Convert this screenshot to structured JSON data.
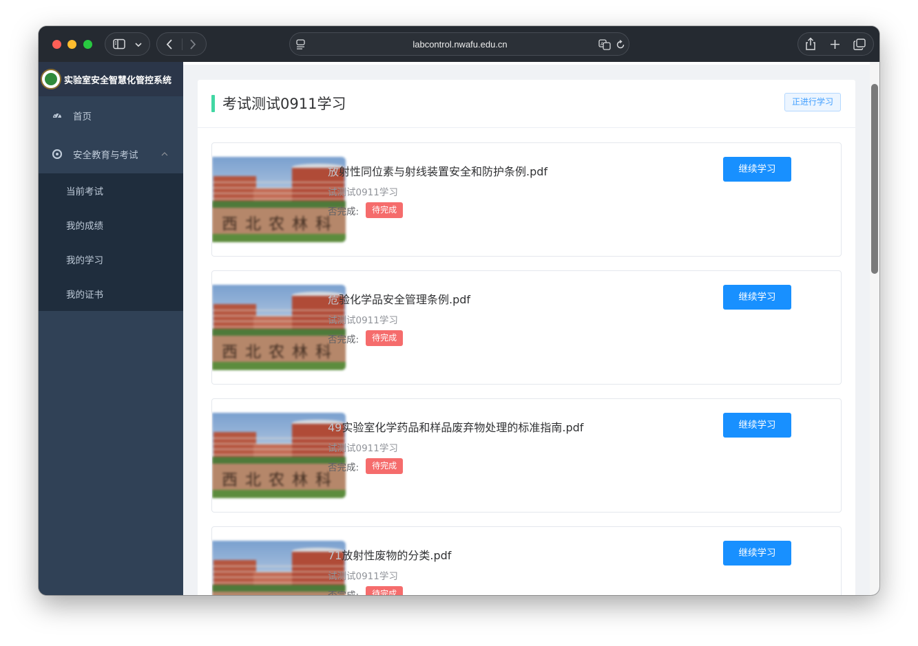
{
  "browser": {
    "url": "labcontrol.nwafu.edu.cn",
    "icons": {
      "sidebar_toggle": "sidebar-icon",
      "back": "chevron-left-icon",
      "forward": "chevron-right-icon",
      "translate": "translate-icon",
      "reload": "reload-icon",
      "share": "share-icon",
      "new_tab": "plus-icon",
      "tabs": "tabs-overview-icon"
    }
  },
  "sidebar": {
    "system_title": "实验室安全智慧化管控系统",
    "menu": [
      {
        "label": "首页",
        "icon": "dashboard-icon"
      },
      {
        "label": "安全教育与考试",
        "icon": "education-icon",
        "expanded": true
      }
    ],
    "submenu": [
      {
        "label": "当前考试"
      },
      {
        "label": "我的成绩"
      },
      {
        "label": "我的学习"
      },
      {
        "label": "我的证书"
      }
    ]
  },
  "main": {
    "title": "考试测试0911学习",
    "status": "正进行学习",
    "items": [
      {
        "title_faded": "放",
        "title": "射性同位素与射线装置安全和防护条例.pdf",
        "subtitle": "试测试0911学习",
        "status_label": "否完成:",
        "status_tag": "待完成",
        "action": "继续学习"
      },
      {
        "title_faded": "危",
        "title": "验化学品安全管理条例.pdf",
        "subtitle": "试测试0911学习",
        "status_label": "否完成:",
        "status_tag": "待完成",
        "action": "继续学习"
      },
      {
        "title_faded": "49",
        "title": "实验室化学药品和样品废弃物处理的标准指南.pdf",
        "subtitle": "试测试0911学习",
        "status_label": "否完成:",
        "status_tag": "待完成",
        "action": "继续学习"
      },
      {
        "title_faded": "71",
        "title": "放射性废物的分类.pdf",
        "subtitle": "试测试0911学习",
        "status_label": "否完成:",
        "status_tag": "待完成",
        "action": "继续学习"
      }
    ],
    "thumbnail_caption": "西北农林科"
  },
  "colors": {
    "sidebar_bg": "#304156",
    "submenu_bg": "#1f2d3d",
    "accent_bar": "#42d7a3",
    "primary_button": "#1890ff",
    "pending_tag": "#f56c6c",
    "status_tag_text": "#409eff"
  }
}
